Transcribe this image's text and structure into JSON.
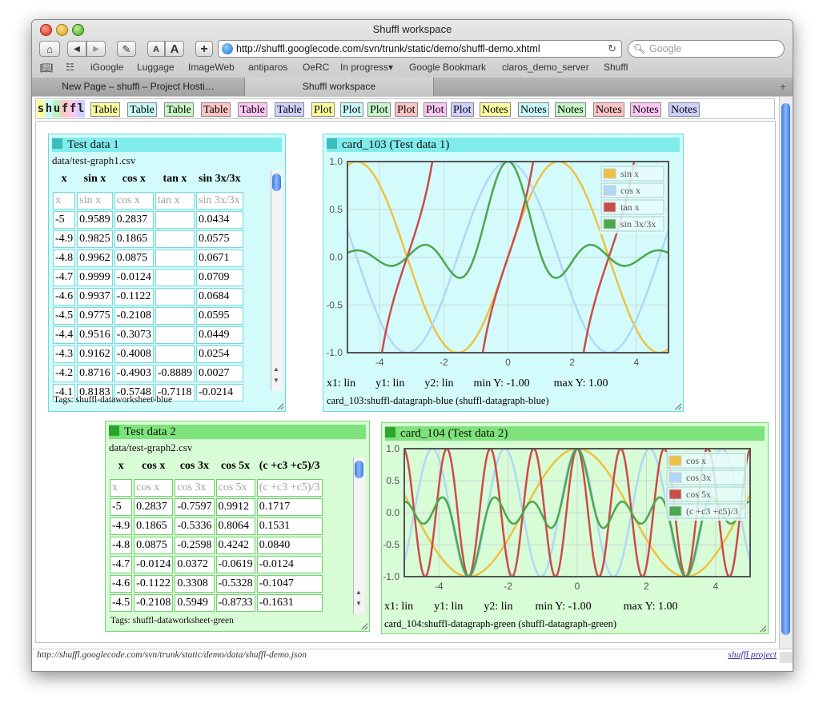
{
  "window": {
    "title": "Shuffl workspace"
  },
  "toolbar": {
    "home": "⌂",
    "back": "◀",
    "forward": "▶",
    "edit": "✎",
    "font_small": "A",
    "font_large": "A",
    "add": "+",
    "url": "http://shuffl.googlecode.com/svn/trunk/static/demo/shuffl-demo.xhtml",
    "reload": "↻",
    "search_placeholder": "Google"
  },
  "bookmarks": [
    "iGoogle",
    "Luggage",
    "ImageWeb",
    "antiparos",
    "OeRC",
    "In progress▾",
    "Google Bookmark",
    "claros_demo_server",
    "Shuffl"
  ],
  "tabs": [
    {
      "label": "New Page – shuffl – Project Hosti…"
    },
    {
      "label": "Shuffl workspace"
    }
  ],
  "shuffl": {
    "logo": [
      "s",
      "h",
      "u",
      "f",
      "f",
      "l"
    ],
    "logo_colors": [
      "#ffff9c",
      "#c8f8f8",
      "#c0f0c0",
      "#ffc8c8",
      "#ffc8f0",
      "#d0d0ff"
    ],
    "palette": [
      {
        "label": "Table",
        "color": "#ffffa0"
      },
      {
        "label": "Table",
        "color": "#c8fafa"
      },
      {
        "label": "Table",
        "color": "#c8f8c8"
      },
      {
        "label": "Table",
        "color": "#ffc4c4"
      },
      {
        "label": "Table",
        "color": "#ffc8f4"
      },
      {
        "label": "Table",
        "color": "#d0d0ff"
      },
      {
        "label": "Plot",
        "color": "#ffffa0"
      },
      {
        "label": "Plot",
        "color": "#c8fafa"
      },
      {
        "label": "Plot",
        "color": "#c8f8c8"
      },
      {
        "label": "Plot",
        "color": "#ffc4c4"
      },
      {
        "label": "Plot",
        "color": "#ffc8f4"
      },
      {
        "label": "Plot",
        "color": "#d0d0ff"
      },
      {
        "label": "Notes",
        "color": "#ffffa0"
      },
      {
        "label": "Notes",
        "color": "#c8fafa"
      },
      {
        "label": "Notes",
        "color": "#c8f8c8"
      },
      {
        "label": "Notes",
        "color": "#ffc4c4"
      },
      {
        "label": "Notes",
        "color": "#ffc8f4"
      },
      {
        "label": "Notes",
        "color": "#d0d0ff"
      }
    ]
  },
  "card1": {
    "title": "Test data 1",
    "file": "data/test-graph1.csv",
    "headers": [
      "x",
      "sin x",
      "cos x",
      "tan x",
      "sin 3x/3x"
    ],
    "rows": [
      [
        "x",
        "sin x",
        "cos x",
        "tan x",
        "sin 3x/3x"
      ],
      [
        "-5",
        "0.9589",
        "0.2837",
        "",
        "0.0434"
      ],
      [
        "-4.9",
        "0.9825",
        "0.1865",
        "",
        "0.0575"
      ],
      [
        "-4.8",
        "0.9962",
        "0.0875",
        "",
        "0.0671"
      ],
      [
        "-4.7",
        "0.9999",
        "-0.0124",
        "",
        "0.0709"
      ],
      [
        "-4.6",
        "0.9937",
        "-0.1122",
        "",
        "0.0684"
      ],
      [
        "-4.5",
        "0.9775",
        "-0.2108",
        "",
        "0.0595"
      ],
      [
        "-4.4",
        "0.9516",
        "-0.3073",
        "",
        "0.0449"
      ],
      [
        "-4.3",
        "0.9162",
        "-0.4008",
        "",
        "0.0254"
      ],
      [
        "-4.2",
        "0.8716",
        "-0.4903",
        "-0.8889",
        "0.0027"
      ],
      [
        "-4.1",
        "0.8183",
        "-0.5748",
        "-0.7118",
        "-0.0214"
      ]
    ],
    "tags": "Tags: shuffl-dataworksheet-blue"
  },
  "card2": {
    "title": "Test data 2",
    "file": "data/test-graph2.csv",
    "headers": [
      "x",
      "cos x",
      "cos 3x",
      "cos 5x",
      "(c +c3 +c5)/3"
    ],
    "rows": [
      [
        "x",
        "cos x",
        "cos 3x",
        "cos 5x",
        "(c +c3 +c5)/3"
      ],
      [
        "-5",
        "0.2837",
        "-0.7597",
        "0.9912",
        "0.1717"
      ],
      [
        "-4.9",
        "0.1865",
        "-0.5336",
        "0.8064",
        "0.1531"
      ],
      [
        "-4.8",
        "0.0875",
        "-0.2598",
        "0.4242",
        "0.0840"
      ],
      [
        "-4.7",
        "-0.0124",
        "0.0372",
        "-0.0619",
        "-0.0124"
      ],
      [
        "-4.6",
        "-0.1122",
        "0.3308",
        "-0.5328",
        "-0.1047"
      ],
      [
        "-4.5",
        "-0.2108",
        "0.5949",
        "-0.8733",
        "-0.1631"
      ]
    ],
    "tags": "Tags: shuffl-dataworksheet-green"
  },
  "card103": {
    "title": "card_103 (Test data 1)",
    "axes": {
      "x1": "x1: lin",
      "y1": "y1: lin",
      "y2": "y2: lin",
      "miny": "min Y: -1.00",
      "maxy": "max Y: 1.00"
    },
    "tags": "card_103:shuffl-datagraph-blue (shuffl-datagraph-blue)"
  },
  "card104": {
    "title": "card_104 (Test data 2)",
    "axes": {
      "x1": "x1: lin",
      "y1": "y1: lin",
      "y2": "y2: lin",
      "miny": "min Y: -1.00",
      "maxy": "max Y: 1.00"
    },
    "tags": "card_104:shuffl-datagraph-green (shuffl-datagraph-green)"
  },
  "status": {
    "left": "http://shuffl.googlecode.com/svn/trunk/static/demo/data/shuffl-demo.json",
    "right": "shuffl project"
  },
  "chart_data": [
    {
      "type": "line",
      "xlim": [
        -5,
        5
      ],
      "ylim": [
        -1,
        1
      ],
      "xticks": [
        -4,
        -2,
        0,
        2,
        4
      ],
      "yticks": [
        1.0,
        0.5,
        0.0,
        -0.5,
        -1.0
      ],
      "ytick_labels": [
        "1.0",
        "0.5",
        "0.0",
        "-0.5",
        "-1.0"
      ],
      "grid": true,
      "legend": "top-right",
      "series": [
        {
          "name": "sin x",
          "color": "#edc240",
          "fn": "sin"
        },
        {
          "name": "cos x",
          "color": "#afd8f8",
          "fn": "cos"
        },
        {
          "name": "tan x",
          "color": "#cb4b4b",
          "fn": "tan"
        },
        {
          "name": "sin 3x/3x",
          "color": "#4da74d",
          "fn": "sinc3"
        }
      ]
    },
    {
      "type": "line",
      "xlim": [
        -5,
        5
      ],
      "ylim": [
        -1,
        1
      ],
      "xticks": [
        -4,
        -2,
        0,
        2,
        4
      ],
      "yticks": [
        1.0,
        0.5,
        0.0,
        -0.5,
        -1.0
      ],
      "ytick_labels": [
        "1.0",
        "0.5",
        "0.0",
        "-0.5",
        "-1.0"
      ],
      "grid": true,
      "legend": "top-right",
      "series": [
        {
          "name": "cos x",
          "color": "#edc240",
          "fn": "cos"
        },
        {
          "name": "cos 3x",
          "color": "#afd8f8",
          "fn": "cos3"
        },
        {
          "name": "cos 5x",
          "color": "#cb4b4b",
          "fn": "cos5"
        },
        {
          "name": "(c +c3 +c5)/3",
          "color": "#4da74d",
          "fn": "avg"
        }
      ]
    }
  ]
}
